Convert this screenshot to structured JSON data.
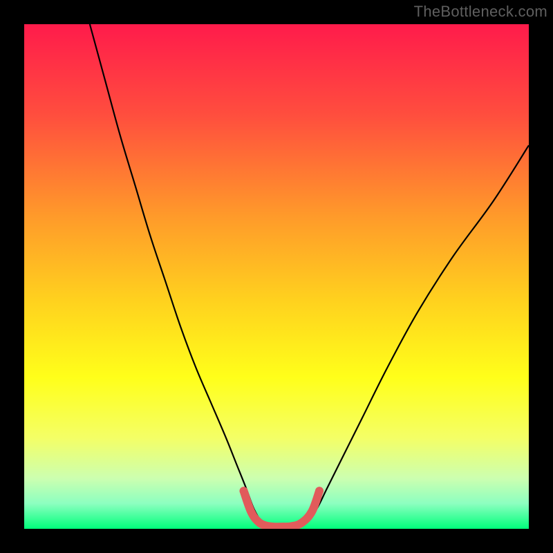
{
  "watermark": "TheBottleneck.com",
  "chart_data": {
    "type": "line",
    "title": "",
    "xlabel": "",
    "ylabel": "",
    "xlim": [
      0,
      100
    ],
    "ylim": [
      0,
      100
    ],
    "grid": false,
    "legend": false,
    "background_gradient": {
      "stops": [
        {
          "offset": 0.0,
          "color": "#ff1b4b"
        },
        {
          "offset": 0.18,
          "color": "#ff4e3e"
        },
        {
          "offset": 0.38,
          "color": "#ff9a2a"
        },
        {
          "offset": 0.55,
          "color": "#ffd21e"
        },
        {
          "offset": 0.7,
          "color": "#ffff1a"
        },
        {
          "offset": 0.82,
          "color": "#f4ff66"
        },
        {
          "offset": 0.9,
          "color": "#ccffb0"
        },
        {
          "offset": 0.95,
          "color": "#8cffc0"
        },
        {
          "offset": 1.0,
          "color": "#00ff7b"
        }
      ]
    },
    "series": [
      {
        "name": "curve",
        "stroke": "#000000",
        "stroke_width": 2.2,
        "x": [
          13,
          16,
          19,
          22,
          25,
          28,
          31,
          34,
          37,
          40,
          42,
          44,
          45.5,
          47,
          48.5,
          50,
          53,
          56,
          58,
          60,
          63,
          67,
          72,
          78,
          85,
          93,
          100
        ],
        "y": [
          100,
          89,
          78,
          68,
          58,
          49,
          40,
          32,
          25,
          18,
          13,
          8,
          4,
          1.5,
          0.6,
          0.4,
          0.5,
          1.5,
          4,
          8,
          14,
          22,
          32,
          43,
          54,
          65,
          76
        ]
      },
      {
        "name": "base-highlight",
        "stroke": "#e15b5b",
        "stroke_width": 12,
        "linecap": "round",
        "x": [
          43.5,
          45,
          46.5,
          48,
          49.5,
          51,
          53,
          55,
          57,
          58.5
        ],
        "y": [
          7.5,
          3.3,
          1.3,
          0.6,
          0.4,
          0.4,
          0.5,
          1.2,
          3.4,
          7.5
        ]
      }
    ],
    "markers": [
      {
        "x": 43.5,
        "y": 7.5,
        "r": 6,
        "fill": "#e15b5b"
      },
      {
        "x": 58.5,
        "y": 7.5,
        "r": 6,
        "fill": "#e15b5b"
      }
    ]
  }
}
